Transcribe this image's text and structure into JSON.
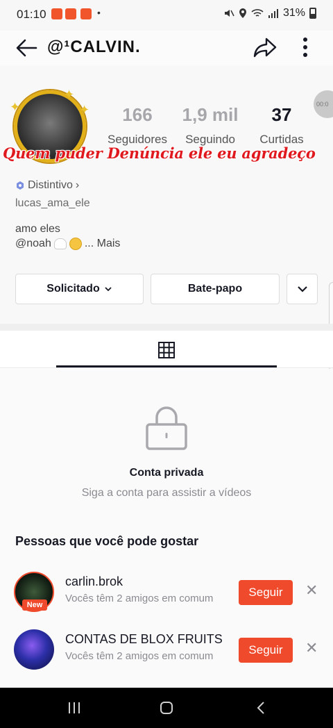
{
  "status_bar": {
    "time": "01:10",
    "battery": "31%",
    "dot": "•"
  },
  "header": {
    "title": "@¹CALVIN."
  },
  "profile": {
    "timer": "00:0",
    "stats": [
      {
        "value": "166",
        "label": "Seguidores"
      },
      {
        "value": "1,9 mil",
        "label": "Seguindo"
      },
      {
        "value": "37",
        "label": "Curtidas"
      }
    ],
    "overlay_text": "Quem puder Denúncia ele eu agradeço",
    "badge_label": "Distintivo",
    "badge_chevron": "›",
    "username": "lucas_ama_ele",
    "bio_line1": "amo eles",
    "bio_line2_prefix": "@noah",
    "bio_more": "...  Mais",
    "buttons": {
      "requested": "Solicitado",
      "requested_chevron": "⌄",
      "chat": "Bate-papo"
    }
  },
  "private": {
    "title": "Conta privada",
    "subtitle": "Siga a conta para assistir a vídeos"
  },
  "suggestions": {
    "header": "Pessoas que você pode gostar",
    "items": [
      {
        "name": "carlin.brok",
        "mutual": "Vocês têm 2 amigos em comum",
        "follow": "Seguir",
        "tag": "New",
        "dismiss": "✕"
      },
      {
        "name": "CONTAS DE BLOX FRUITS",
        "mutual": "Vocês têm 2 amigos em comum",
        "follow": "Seguir",
        "dismiss": "✕"
      }
    ]
  },
  "icons": {
    "back": "back-arrow-icon",
    "share": "share-icon",
    "more": "more-vertical-icon",
    "badge": "badge-hexagon-icon",
    "grid": "grid-icon",
    "lock": "lock-icon",
    "dropdown": "chevron-down-icon"
  },
  "colors": {
    "accent": "#f04a2c",
    "overlay_text": "#e0191e",
    "muted_stats": "#a7a7ab"
  }
}
